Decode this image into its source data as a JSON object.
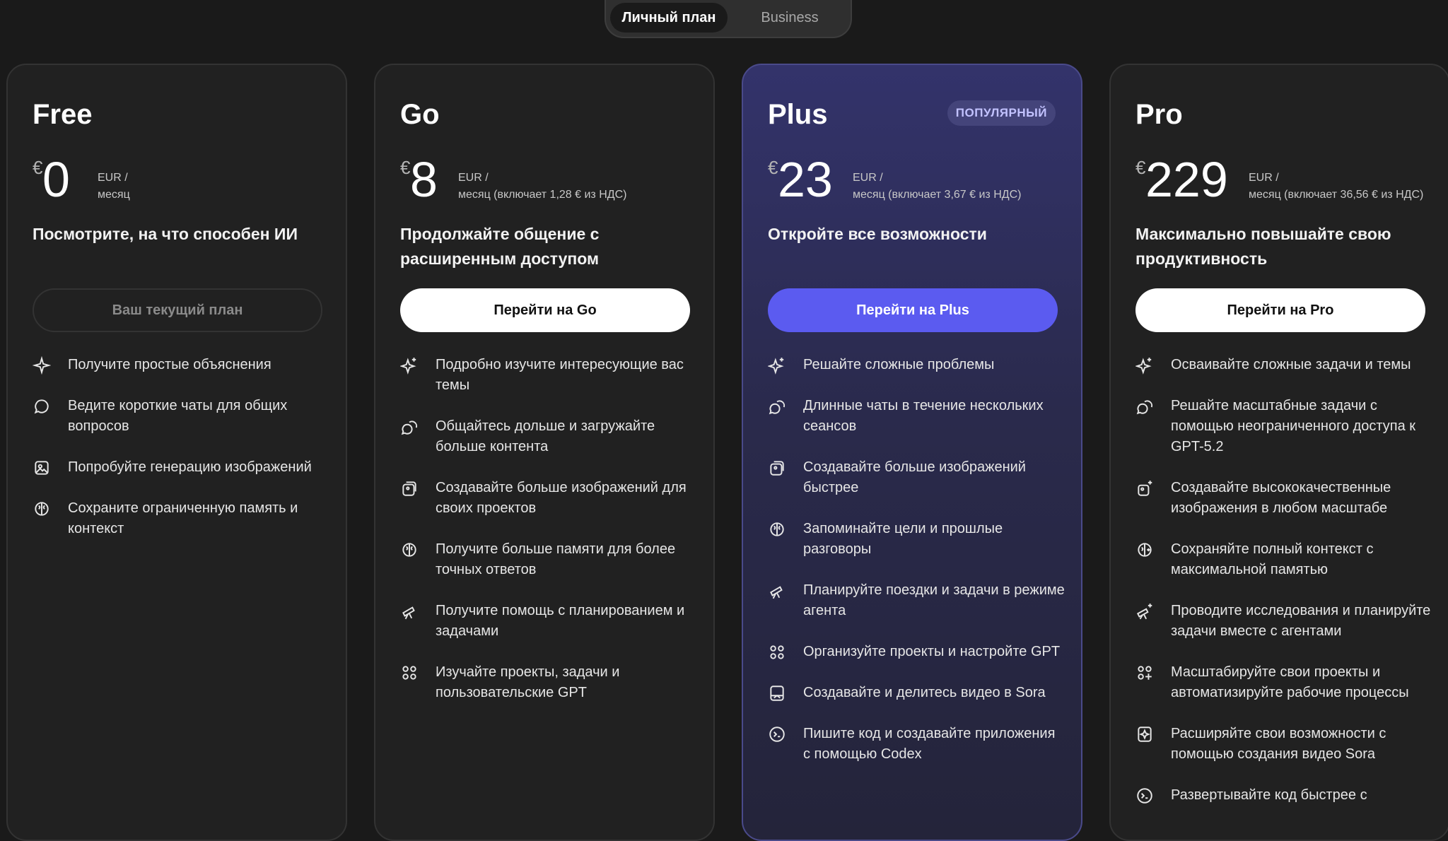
{
  "plan_toggle": {
    "active": "Личный план",
    "inactive": "Business"
  },
  "accent_color": "#5b5bf0",
  "plans": [
    {
      "name": "Free",
      "currency": "€",
      "amount": "0",
      "period_line1": "EUR /",
      "period_line2": "месяц",
      "tagline": "Посмотрите, на что способен ИИ",
      "cta": "Ваш текущий план",
      "features": [
        {
          "icon": "sparkle-icon",
          "text": "Получите простые объяснения"
        },
        {
          "icon": "chat-bubble-icon",
          "text": "Ведите короткие чаты для общих вопросов"
        },
        {
          "icon": "image-icon",
          "text": "Попробуйте генерацию изображений"
        },
        {
          "icon": "brain-icon",
          "text": "Сохраните ограниченную память и контекст"
        }
      ]
    },
    {
      "name": "Go",
      "currency": "€",
      "amount": "8",
      "period_line1": "EUR /",
      "period_line2": "месяц (включает 1,28 € из НДС)",
      "tagline": "Продолжайте общение с расширенным доступом",
      "cta": "Перейти на Go",
      "features": [
        {
          "icon": "sparkles-icon",
          "text": "Подробно изучите интересующие вас темы"
        },
        {
          "icon": "chat-bubbles-icon",
          "text": "Общайтесь дольше и загружайте больше контента"
        },
        {
          "icon": "images-icon",
          "text": "Создавайте больше изображений для своих проектов"
        },
        {
          "icon": "brain-icon",
          "text": "Получите больше памяти для более точных ответов"
        },
        {
          "icon": "telescope-icon",
          "text": "Получите помощь с планированием и задачами"
        },
        {
          "icon": "apps-icon",
          "text": "Изучайте проекты, задачи и пользовательские GPT"
        }
      ]
    },
    {
      "name": "Plus",
      "badge": "ПОПУЛЯРНЫЙ",
      "currency": "€",
      "amount": "23",
      "period_line1": "EUR /",
      "period_line2": "месяц (включает 3,67 € из НДС)",
      "tagline": "Откройте все возможности",
      "cta": "Перейти на Plus",
      "features": [
        {
          "icon": "sparkles-icon",
          "text": "Решайте сложные проблемы"
        },
        {
          "icon": "chat-bubbles-icon",
          "text": "Длинные чаты в течение нескольких сеансов"
        },
        {
          "icon": "images-icon",
          "text": "Создавайте больше изображений быстрее"
        },
        {
          "icon": "brain-icon",
          "text": "Запоминайте цели и прошлые разговоры"
        },
        {
          "icon": "telescope-icon",
          "text": "Планируйте поездки и задачи в режиме агента"
        },
        {
          "icon": "apps-icon",
          "text": "Организуйте проекты и настройте GPT"
        },
        {
          "icon": "video-icon",
          "text": "Создавайте и делитесь видео в Sora"
        },
        {
          "icon": "terminal-icon",
          "text": "Пишите код и создавайте приложения с помощью Codex"
        }
      ]
    },
    {
      "name": "Pro",
      "currency": "€",
      "amount": "229",
      "period_line1": "EUR /",
      "period_line2": "месяц (включает 36,56 € из НДС)",
      "tagline": "Максимально повышайте свою продуктивность",
      "cta": "Перейти на Pro",
      "features": [
        {
          "icon": "sparkles-icon",
          "text": "Осваивайте сложные задачи и темы"
        },
        {
          "icon": "chat-bubbles-icon",
          "text": "Решайте масштабные задачи с помощью неограниченного доступа к GPT-5.2"
        },
        {
          "icon": "images-sparkle-icon",
          "text": "Создавайте высококачественные изображения в любом масштабе"
        },
        {
          "icon": "brain-plus-icon",
          "text": "Сохраняйте полный контекст с максимальной памятью"
        },
        {
          "icon": "telescope-sparkle-icon",
          "text": "Проводите исследования и планируйте задачи вместе с агентами"
        },
        {
          "icon": "apps-plus-icon",
          "text": "Масштабируйте свои проекты и автоматизируйте рабочие процессы"
        },
        {
          "icon": "video-sparkle-icon",
          "text": "Расширяйте свои возможности с помощью создания видео Sora"
        },
        {
          "icon": "terminal-icon",
          "text": "Развертывайте код быстрее с"
        }
      ]
    }
  ]
}
